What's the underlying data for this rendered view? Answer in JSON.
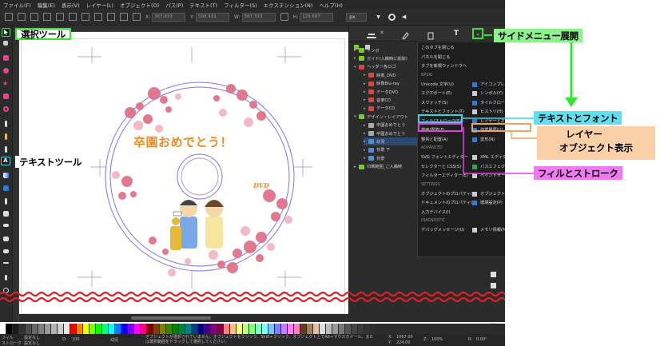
{
  "menubar": [
    "ファイル(F)",
    "編集(E)",
    "表示(V)",
    "レイヤー(L)",
    "オブジェクト(O)",
    "パス(P)",
    "テキスト(T)",
    "フィルター(S)",
    "エクステンション(N)",
    "ヘルプ(H)"
  ],
  "controls": {
    "x_label": "X:",
    "x_value": "367.833",
    "y_label": "Y:",
    "y_value": "598.931",
    "w_label": "W:",
    "w_value": "567.333",
    "h_label": "H:",
    "h_value": "129.697",
    "unit": "px"
  },
  "canvas": {
    "headline": "卒園おめでとう！",
    "headline_color": "#f08a1c",
    "badge": "DVD",
    "badge_color": "#f08a1c"
  },
  "layers": [
    {
      "label": "トンボ",
      "indent": 0,
      "color": "#7acc29",
      "open": false
    },
    {
      "label": "ガイド(入稿時に削除)",
      "indent": 0,
      "color": "#7acc29",
      "open": false
    },
    {
      "label": "ヘッダー各ロゴ",
      "indent": 0,
      "color": "#e0443a",
      "open": true
    },
    {
      "label": "映像_DVD",
      "indent": 1,
      "color": "#e0443a",
      "open": false
    },
    {
      "label": "映像Blu-ray",
      "indent": 1,
      "color": "#e0443a",
      "open": false
    },
    {
      "label": "データDVD",
      "indent": 1,
      "color": "#e0443a",
      "open": false
    },
    {
      "label": "音楽CD",
      "indent": 1,
      "color": "#e0443a",
      "open": false
    },
    {
      "label": "データCD",
      "indent": 1,
      "color": "#e0443a",
      "open": false
    },
    {
      "label": "デザイン・レイアウト",
      "indent": 0,
      "color": "#7acc29",
      "open": true
    },
    {
      "label": "卒園おめでとう",
      "indent": 1,
      "color": "#aaaaaa",
      "open": false
    },
    {
      "label": "卒園おめでとう",
      "indent": 1,
      "color": "#aaaaaa",
      "open": false
    },
    {
      "label": "幼児",
      "indent": 1,
      "color": "#4a8fd8",
      "open": false
    },
    {
      "label": "背景 下",
      "indent": 1,
      "color": "#4a8fd8",
      "open": false
    },
    {
      "label": "背景",
      "indent": 1,
      "color": "#4a8fd8",
      "open": false
    },
    {
      "label": "印刷範囲_ご入稿時",
      "indent": 0,
      "color": "#7acc29",
      "open": false
    }
  ],
  "dropdown": {
    "items": [
      {
        "kind": "item",
        "label": "このタブを閉じる"
      },
      {
        "kind": "item",
        "label": "パネルを閉じる"
      },
      {
        "kind": "item",
        "label": "タブを新規ウィンドウへ"
      },
      {
        "kind": "header",
        "label": "BASIC"
      },
      {
        "kind": "pair",
        "left": "Unicode 文字(U)",
        "right": "アイコンプレビュー"
      },
      {
        "kind": "pair",
        "left": "エクスポート(E)",
        "right": "シンボル(Y)"
      },
      {
        "kind": "pair",
        "left": "スウォッチ(S)",
        "right": "タイルクローンを作成"
      },
      {
        "kind": "pair",
        "left": "テキストとフォント(T)",
        "right": "ヒストリ(H)"
      },
      {
        "kind": "pair",
        "left": "フィル/ストローク(F)",
        "right": "レイヤーとオブジェクト(L)"
      },
      {
        "kind": "pair",
        "left": "検索/置換(F)",
        "right": "作業履歴(U)"
      },
      {
        "kind": "pair",
        "left": "整列と配置(A)",
        "right": "変形(N)"
      },
      {
        "kind": "header",
        "label": "ADVANCED"
      },
      {
        "kind": "pair",
        "left": "SVG フォントエディター",
        "right": "XML エディター(X)"
      },
      {
        "kind": "pair",
        "left": "セレクターと CSS(S)",
        "right": "パスエフェクト"
      },
      {
        "kind": "pair",
        "left": "フィルターエディター(E)",
        "right": "ペイントサーバー(S)"
      },
      {
        "kind": "header",
        "label": "SETTINGS"
      },
      {
        "kind": "pair",
        "left": "オブジェクトのプロパティ(O)",
        "right": "オブジェクトの属性(O)"
      },
      {
        "kind": "pair",
        "left": "ドキュメントのプロパティ(D)",
        "right": "環境設定(P)"
      },
      {
        "kind": "item",
        "label": "入力デバイス(I)"
      },
      {
        "kind": "header",
        "label": "DIAGNOSTIC"
      },
      {
        "kind": "pair",
        "left": "デバッグメッセージ(U)",
        "right": "メモリ情報(M)"
      }
    ]
  },
  "callouts": {
    "select_tool": "選択ツール",
    "text_tool": "テキストツール",
    "side_menu": "サイドメニュー展開",
    "text_font": "テキストとフォント",
    "layer_obj_line1": "レイヤー",
    "layer_obj_line2": "オブジェクト表示",
    "fill_stroke": "フィルとストローク"
  },
  "colors": {
    "green": "#2fe82f",
    "cyan": "#39d3e6",
    "orange": "#f2a35c",
    "magenta": "#e03fe0",
    "green_bg": "#8cf08c",
    "cyan_bg": "#5ee0f0",
    "orange_bg": "#f9d0a8",
    "magenta_bg": "#f07af0"
  },
  "status": {
    "fill_label": "フィル",
    "fill_value": "設定なし",
    "stroke_label": "ストローク",
    "stroke_value": "設定なし",
    "opacity_label": "O:",
    "opacity_value": "100",
    "layer_name": "幼児",
    "message": "オブジェクトが選択されていません。オブジェクトをクリック、Shift+クリック、オブジェクト上でAlt+マウスホイール、または選択範囲をドラッグして選択してください。",
    "x_label": "X:",
    "x_value": "1067.00",
    "y_label": "Y:",
    "y_value": "224.00",
    "zoom_label": "Z:",
    "zoom_value": "100%",
    "rot_label": "R:",
    "rot_value": "0.00°"
  },
  "icons": [
    "select-icon",
    "node-icon",
    "rect-icon",
    "circle-icon",
    "star-icon",
    "spiral-icon",
    "pen-icon",
    "pencil-icon",
    "calligraphy-icon",
    "text-icon",
    "gradient-icon",
    "mesh-icon",
    "dropper-icon",
    "paint-bucket-icon",
    "tweak-icon",
    "spray-icon",
    "eraser-icon",
    "connector-icon",
    "measure-icon",
    "zoom-icon"
  ]
}
